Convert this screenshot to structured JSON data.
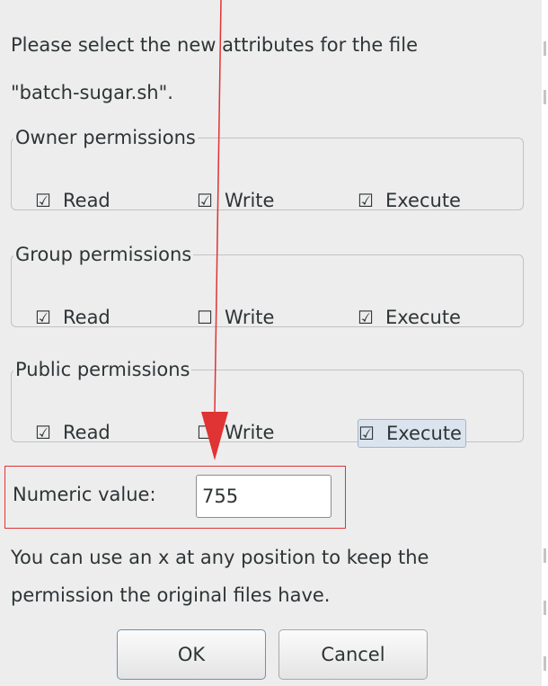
{
  "dialog": {
    "message_line1": "Please select the new attributes for the file",
    "message_line2": "\"batch-sugar.sh\".",
    "groups": [
      {
        "legend": "Owner permissions",
        "read": {
          "label": "Read",
          "checked": true
        },
        "write": {
          "label": "Write",
          "checked": true
        },
        "execute": {
          "label": "Execute",
          "checked": true
        }
      },
      {
        "legend": "Group permissions",
        "read": {
          "label": "Read",
          "checked": true
        },
        "write": {
          "label": "Write",
          "checked": false
        },
        "execute": {
          "label": "Execute",
          "checked": true
        }
      },
      {
        "legend": "Public permissions",
        "read": {
          "label": "Read",
          "checked": true
        },
        "write": {
          "label": "Write",
          "checked": false
        },
        "execute": {
          "label": "Execute",
          "checked": true
        }
      }
    ],
    "numeric_label": "Numeric value:",
    "numeric_value": "755",
    "hint_line1": "You can use an x at any position to keep the",
    "hint_line2": "permission the original files have.",
    "ok_label": "OK",
    "cancel_label": "Cancel"
  },
  "glyphs": {
    "checked": "☑",
    "unchecked": "☐"
  },
  "colors": {
    "annotation": "#e03333",
    "dialog_bg": "#ededed",
    "focus_bg": "#dbe4ee"
  },
  "icons": [
    "arrow-annotation-icon",
    "checkbox-icon"
  ]
}
